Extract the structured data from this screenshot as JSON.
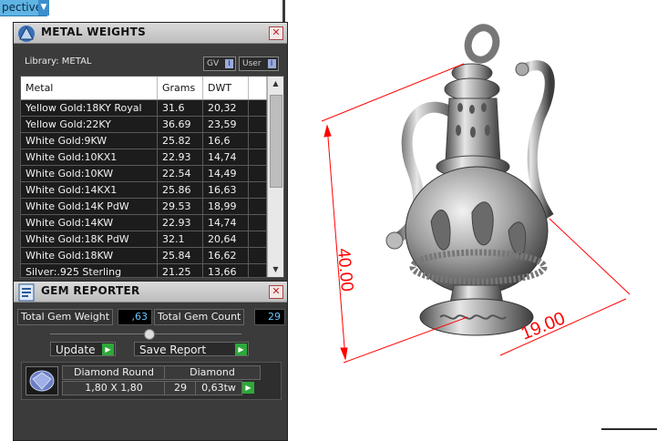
{
  "viewport": {
    "mode_label": "pective",
    "dimension_height": "40.00",
    "dimension_width": "19.00",
    "accent_color": "#ff0000"
  },
  "metal_panel": {
    "title": "METAL WEIGHTS",
    "library_label": "Library: METAL",
    "toggles": [
      "GV",
      "User"
    ],
    "columns": [
      "Metal",
      "Grams",
      "DWT"
    ],
    "rows": [
      {
        "metal": "Yellow Gold:18KY Royal",
        "grams": "31.6",
        "dwt": "20,32"
      },
      {
        "metal": "Yellow Gold:22KY",
        "grams": "36.69",
        "dwt": "23,59"
      },
      {
        "metal": "White Gold:9KW",
        "grams": "25.82",
        "dwt": "16,6"
      },
      {
        "metal": "White Gold:10KX1",
        "grams": "22.93",
        "dwt": "14,74"
      },
      {
        "metal": "White Gold:10KW",
        "grams": "22.54",
        "dwt": "14,49"
      },
      {
        "metal": "White Gold:14KX1",
        "grams": "25.86",
        "dwt": "16,63"
      },
      {
        "metal": "White Gold:14K PdW",
        "grams": "29.53",
        "dwt": "18,99"
      },
      {
        "metal": "White Gold:14KW",
        "grams": "22.93",
        "dwt": "14,74"
      },
      {
        "metal": "White Gold:18K PdW",
        "grams": "32.1",
        "dwt": "20,64"
      },
      {
        "metal": "White Gold:18KW",
        "grams": "25.84",
        "dwt": "16,62"
      },
      {
        "metal": "Silver:.925 Sterling",
        "grams": "21.25",
        "dwt": "13,66"
      }
    ]
  },
  "gem_panel": {
    "title": "GEM REPORTER",
    "total_weight_label": "Total Gem Weight",
    "total_weight_value": ",63",
    "total_count_label": "Total Gem Count",
    "total_count_value": "29",
    "update_label": "Update",
    "save_label": "Save Report",
    "gem": {
      "name": "Diamond Round",
      "material": "Diamond",
      "size": "1,80 X 1,80",
      "count": "29",
      "weight": "0,63tw"
    }
  }
}
